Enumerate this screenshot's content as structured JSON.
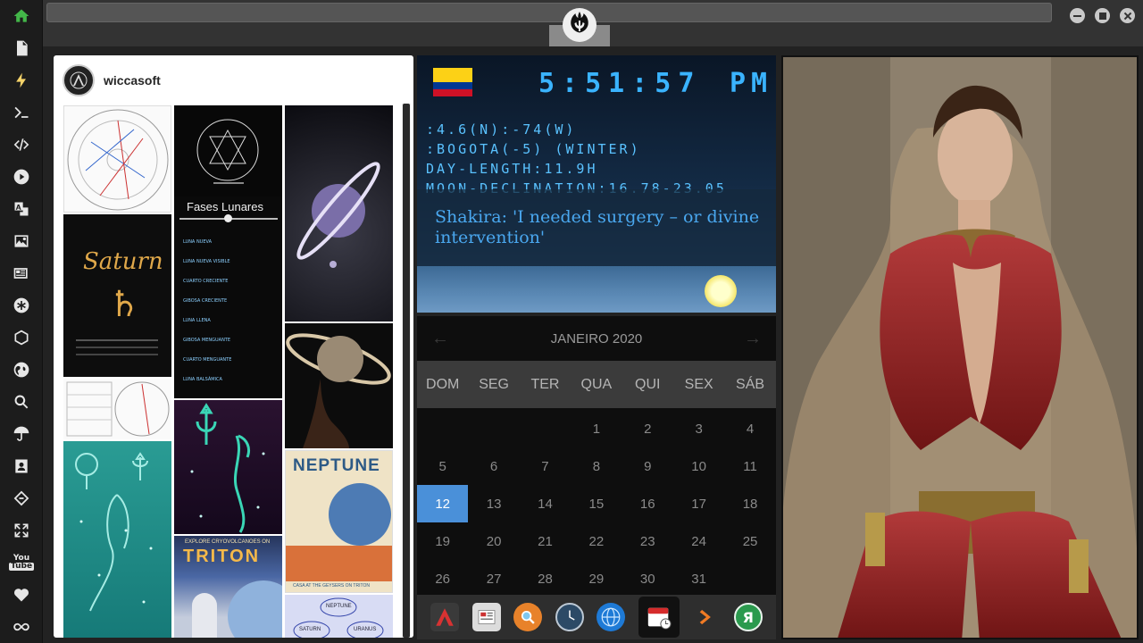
{
  "sidebar": {
    "items": [
      {
        "name": "home-icon",
        "glyph": "⌂"
      },
      {
        "name": "document-icon",
        "glyph": "▤"
      },
      {
        "name": "lightning-icon",
        "glyph": "ϟ"
      },
      {
        "name": "terminal-icon",
        "glyph": ">_"
      },
      {
        "name": "code-icon",
        "glyph": "</>"
      },
      {
        "name": "play-icon",
        "glyph": "▶"
      },
      {
        "name": "translate-icon",
        "glyph": "A"
      },
      {
        "name": "image-icon",
        "glyph": "▨"
      },
      {
        "name": "newspaper-icon",
        "glyph": "▦"
      },
      {
        "name": "asterisk-icon",
        "glyph": "✱"
      },
      {
        "name": "polygon-icon",
        "glyph": "⬡"
      },
      {
        "name": "globe-icon",
        "glyph": "●"
      },
      {
        "name": "search-icon",
        "glyph": "⌕"
      },
      {
        "name": "umbrella-icon",
        "glyph": "☂"
      },
      {
        "name": "contact-card-icon",
        "glyph": "▣"
      },
      {
        "name": "diamond-link-icon",
        "glyph": "◈"
      },
      {
        "name": "expand-icon",
        "glyph": "✥"
      },
      {
        "name": "youtube-icon",
        "glyph": "You Tube"
      },
      {
        "name": "heart-icon",
        "glyph": "♥"
      },
      {
        "name": "infinity-icon",
        "glyph": "∞"
      }
    ]
  },
  "colors": {
    "accent_green": "#43b649",
    "clock_digits": "#3ab3ff",
    "calendar_today": "#4a90d9"
  },
  "instagram": {
    "username": "wiccasoft",
    "tiles": {
      "fases_title": "Fases Lunares",
      "fases_rows": [
        "LUNA NUEVA",
        "LUNA NUEVA VISIBLE",
        "CUARTO CRECIENTE",
        "GIBOSA CRECIENTE",
        "LUNA LLENA",
        "GIBOSA MENGUANTE",
        "CUARTO MENGUANTE",
        "LUNA BALSÁMICA"
      ],
      "saturn_title": "Saturn",
      "neptune_title": "NEPTUNE",
      "triton_title": "TRITON",
      "triton_kicker": "EXPLORE CRYOVOLCANOES ON",
      "neptune_caption": "CASA AT THE GEYSERS ON TRITON",
      "diagram_labels": [
        "NEPTUNE",
        "SATURN",
        "URANUS"
      ]
    }
  },
  "clock": {
    "time": "5:51:57",
    "ampm": "PM",
    "lines": [
      ":4.6(N):-74(W)",
      ":BOGOTA(-5) (WINTER)",
      "DAY-LENGTH:11.9H",
      "MOON-DECLINATION:16.78-23.05"
    ],
    "headline": "Shakira: 'I needed surgery – or divine intervention'"
  },
  "calendar": {
    "month_label": "JANEIRO 2020",
    "weekdays": [
      "DOM",
      "SEG",
      "TER",
      "QUA",
      "QUI",
      "SEX",
      "SÁB"
    ],
    "weeks": [
      [
        "",
        "",
        "",
        "1",
        "2",
        "3",
        "4"
      ],
      [
        "5",
        "6",
        "7",
        "8",
        "9",
        "10",
        "11"
      ],
      [
        "12",
        "13",
        "14",
        "15",
        "16",
        "17",
        "18"
      ],
      [
        "19",
        "20",
        "21",
        "22",
        "23",
        "24",
        "25"
      ],
      [
        "26",
        "27",
        "28",
        "29",
        "30",
        "31",
        ""
      ]
    ],
    "today": "12"
  },
  "dock": {
    "items": [
      {
        "name": "app-red-a-icon",
        "glyph": "▲",
        "color": "#d83232"
      },
      {
        "name": "news-reader-icon",
        "glyph": "▤",
        "color": "#777777"
      },
      {
        "name": "magnifier-app-icon",
        "glyph": "⌕",
        "color": "#e8822a"
      },
      {
        "name": "clock-app-icon",
        "glyph": "◷",
        "color": "#3c6a8c"
      },
      {
        "name": "web-globe-icon",
        "glyph": "⊕",
        "color": "#1e7ad6"
      },
      {
        "name": "calendar-app-icon",
        "glyph": "▦",
        "color": "#d62b2b"
      },
      {
        "name": "play-arrow-app-icon",
        "glyph": "❯",
        "color": "#2e2e2e"
      },
      {
        "name": "yandex-icon",
        "glyph": "Я",
        "color": "#2b9a4e"
      }
    ]
  }
}
